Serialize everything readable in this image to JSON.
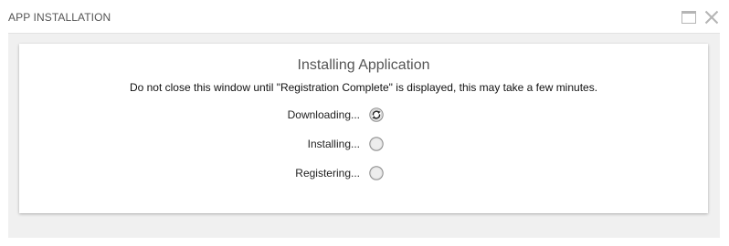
{
  "window": {
    "title": "APP INSTALLATION"
  },
  "panel": {
    "title": "Installing Application",
    "subtitle": "Do not close this window until \"Registration Complete\" is displayed, this may take a few minutes."
  },
  "steps": [
    {
      "label": "Downloading...",
      "status": "in-progress",
      "icon": "refresh-icon"
    },
    {
      "label": "Installing...",
      "status": "pending",
      "icon": "radio-empty-icon"
    },
    {
      "label": "Registering...",
      "status": "pending",
      "icon": "radio-empty-icon"
    }
  ],
  "colors": {
    "title_text": "#555555",
    "body_background": "#f0f0f0",
    "panel_background": "#ffffff",
    "icon_gray": "#b8b8b8"
  }
}
